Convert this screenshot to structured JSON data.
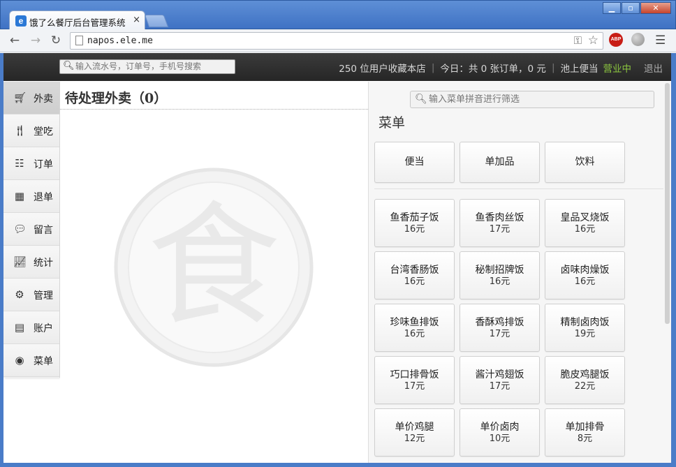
{
  "browser": {
    "tab_title": "饿了么餐厅后台管理系统",
    "tab_close": "×",
    "url": "napos.ele.me",
    "favicon": "e",
    "abp": "ABP",
    "win_min": "▁",
    "win_max": "▫",
    "win_close": "✕"
  },
  "header": {
    "search_placeholder": "输入流水号，订单号，手机号搜索",
    "favorites": "250 位用户收藏本店",
    "today": "今日：共 0 张订单，0 元",
    "store_name": "池上便当",
    "status": "营业中",
    "logout": "退出",
    "colors": {
      "status": "#8cc63f"
    }
  },
  "sidebar": {
    "items": [
      {
        "label": "外卖",
        "icon": "cart-icon",
        "active": true
      },
      {
        "label": "堂吃",
        "icon": "fork-knife-icon"
      },
      {
        "label": "订单",
        "icon": "list-icon"
      },
      {
        "label": "退单",
        "icon": "refund-icon"
      },
      {
        "label": "留言",
        "icon": "comment-icon"
      },
      {
        "label": "统计",
        "icon": "chart-icon"
      },
      {
        "label": "管理",
        "icon": "gear-icon"
      },
      {
        "label": "账户",
        "icon": "wallet-icon"
      },
      {
        "label": "菜单",
        "icon": "food-icon"
      }
    ]
  },
  "pending": {
    "title": "待处理外卖（0）",
    "emblem_char": "食"
  },
  "menu": {
    "filter_placeholder": "输入菜单拼音进行筛选",
    "heading": "菜单",
    "categories": [
      "便当",
      "单加品",
      "饮料"
    ],
    "dishes": [
      {
        "name": "鱼香茄子饭",
        "price": "16元"
      },
      {
        "name": "鱼香肉丝饭",
        "price": "17元"
      },
      {
        "name": "皇品叉烧饭",
        "price": "16元"
      },
      {
        "name": "台湾香肠饭",
        "price": "16元"
      },
      {
        "name": "秘制招牌饭",
        "price": "16元"
      },
      {
        "name": "卤味肉燥饭",
        "price": "16元"
      },
      {
        "name": "珍味鱼排饭",
        "price": "16元"
      },
      {
        "name": "香酥鸡排饭",
        "price": "17元"
      },
      {
        "name": "精制卤肉饭",
        "price": "19元"
      },
      {
        "name": "巧口排骨饭",
        "price": "17元"
      },
      {
        "name": "酱汁鸡翅饭",
        "price": "17元"
      },
      {
        "name": "脆皮鸡腿饭",
        "price": "22元"
      },
      {
        "name": "单价鸡腿",
        "price": "12元"
      },
      {
        "name": "单价卤肉",
        "price": "10元"
      },
      {
        "name": "单加排骨",
        "price": "8元"
      }
    ]
  }
}
